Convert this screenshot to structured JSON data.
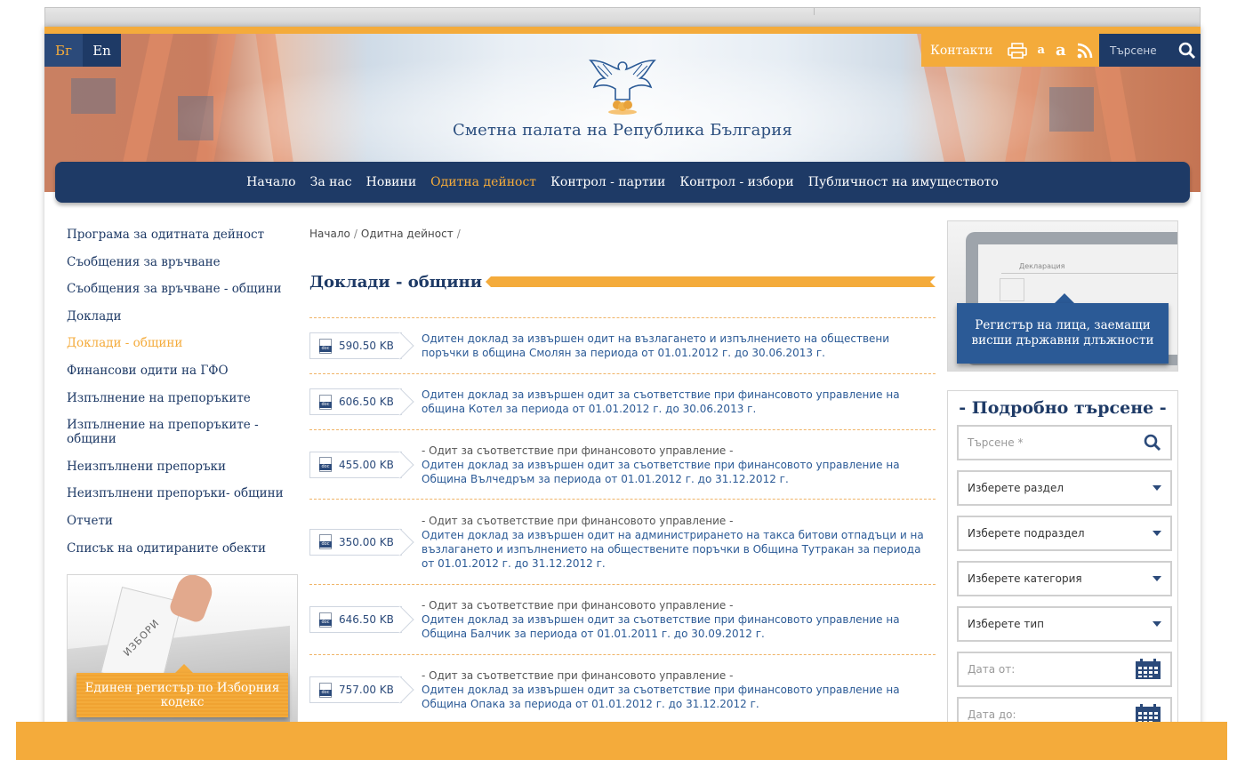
{
  "lang": {
    "bg": "Бг",
    "en": "En"
  },
  "util": {
    "contacts": "Контакти",
    "font_small": "a",
    "font_large": "a",
    "search_placeholder": "Търсене"
  },
  "site": {
    "title": "Сметна палата на Република България"
  },
  "nav": [
    {
      "label": "Начало",
      "active": false
    },
    {
      "label": "За нас",
      "active": false
    },
    {
      "label": "Новини",
      "active": false
    },
    {
      "label": "Одитна дейност",
      "active": true
    },
    {
      "label": "Контрол - партии",
      "active": false
    },
    {
      "label": "Контрол - избори",
      "active": false
    },
    {
      "label": "Публичност на имуществото",
      "active": false
    }
  ],
  "sidebar": {
    "items": [
      {
        "label": "Програма за одитната дейност",
        "active": false
      },
      {
        "label": "Съобщения за връчване",
        "active": false
      },
      {
        "label": "Съобщения за връчване - общини",
        "active": false
      },
      {
        "label": "Доклади",
        "active": false
      },
      {
        "label": "Доклади - общини",
        "active": true
      },
      {
        "label": "Финансови одити на ГФО",
        "active": false
      },
      {
        "label": "Изпълнение на препоръките",
        "active": false
      },
      {
        "label": "Изпълнение на препоръките - общини",
        "active": false
      },
      {
        "label": "Неизпълнени препоръки",
        "active": false
      },
      {
        "label": "Неизпълнени препоръки- общини",
        "active": false
      },
      {
        "label": "Отчети",
        "active": false
      },
      {
        "label": "Списък на одитираните обекти",
        "active": false
      }
    ],
    "vote_banner": "Единен регистър по Изборния кодекс",
    "vote_paper": "ИЗБОРИ"
  },
  "breadcrumb": [
    "Начало",
    "Одитна дейност"
  ],
  "page_title": "Доклади - общини",
  "documents": [
    {
      "size": "590.50 KB",
      "category": "",
      "title": "Одитен доклад за извършен одит на възлагането и изпълнението на обществени поръчки в община Смолян за периода от 01.01.2012 г. до 30.06.2013 г."
    },
    {
      "size": "606.50 KB",
      "category": "",
      "title": "Одитен доклад за извършен одит за съответствие при финансовото управление на община Котел за периода от 01.01.2012 г. до 30.06.2013 г."
    },
    {
      "size": "455.00 KB",
      "category": "- Одит за съответствие при финансовото управление -",
      "title": "Одитен доклад за извършен одит за съответствие при финансовото управление на Община Вълчедръм за периода от 01.01.2012 г. до 31.12.2012 г."
    },
    {
      "size": "350.00 KB",
      "category": "- Одит за съответствие при финансовото управление -",
      "title": "Одитен доклад за извършен одит на администрирането на такса битови отпадъци и на възлагането и изпълнението на обществените поръчки в Община Тутракан за периода от 01.01.2012 г. до 31.12.2012 г."
    },
    {
      "size": "646.50 KB",
      "category": "- Одит за съответствие при финансовото управление -",
      "title": "Одитен доклад за извършен одит за съответствие при финансовото управление на Община Балчик за периода от 01.01.2011 г. до 30.09.2012 г."
    },
    {
      "size": "757.00 KB",
      "category": "- Одит за съответствие при финансовото управление -",
      "title": "Одитен доклад за извършен одит за съответствие при финансовото управление на Община Опака за периода от 01.01.2012 г. до 31.12.2012 г."
    }
  ],
  "doc_icon_label": "doc",
  "register_banner": "Регистър на лица, заемащи висши държавни длъжности",
  "register_screen_title": "Декларация",
  "adv_search": {
    "title": "- Подробно търсене -",
    "query_placeholder": "Търсене *",
    "section": "Изберете раздел",
    "subsection": "Изберете подраздел",
    "category": "Изберете категория",
    "type": "Изберете тип",
    "date_from": "Дата от:",
    "date_to": "Дата до:"
  },
  "colors": {
    "navy": "#1e3a66",
    "orange": "#f4ab3b",
    "link_blue": "#2b5a96"
  }
}
